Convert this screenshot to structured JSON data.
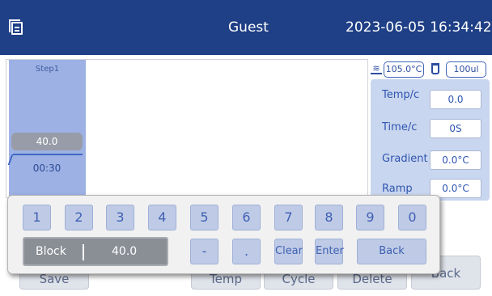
{
  "header": {
    "icon": "document-list-icon",
    "user": "Guest",
    "datetime": "2023-06-05 16:34:42"
  },
  "graph": {
    "step_label": "Step1",
    "temperature": "40.0",
    "time": "00:30"
  },
  "status": {
    "lid_icon": "heated-lid-icon",
    "lid_temp": "105.0°C",
    "volume_icon": "tube-volume-icon",
    "volume": "100ul"
  },
  "params": [
    {
      "label": "Temp/c",
      "value": "0.0"
    },
    {
      "label": "Time/c",
      "value": "0S"
    },
    {
      "label": "Gradient",
      "value": "0.0°C"
    },
    {
      "label": "Ramp",
      "value": "0.0°C"
    }
  ],
  "bottom_buttons": [
    "Save",
    "Temp",
    "Cycle",
    "Delete",
    "Back"
  ],
  "keypad": {
    "digits": [
      "1",
      "2",
      "3",
      "4",
      "5",
      "6",
      "7",
      "8",
      "9",
      "0"
    ],
    "display_label": "Block",
    "display_value": "40.0",
    "minus": "-",
    "dot": ".",
    "clear": "Clear",
    "enter": "Enter",
    "back": "Back"
  },
  "colors": {
    "header_bg": "#1f3f86",
    "step_fill": "#9db1e4",
    "panel_bg": "#c9d6ef",
    "key_bg": "#bfcbe6",
    "accent": "#2e55b0"
  }
}
